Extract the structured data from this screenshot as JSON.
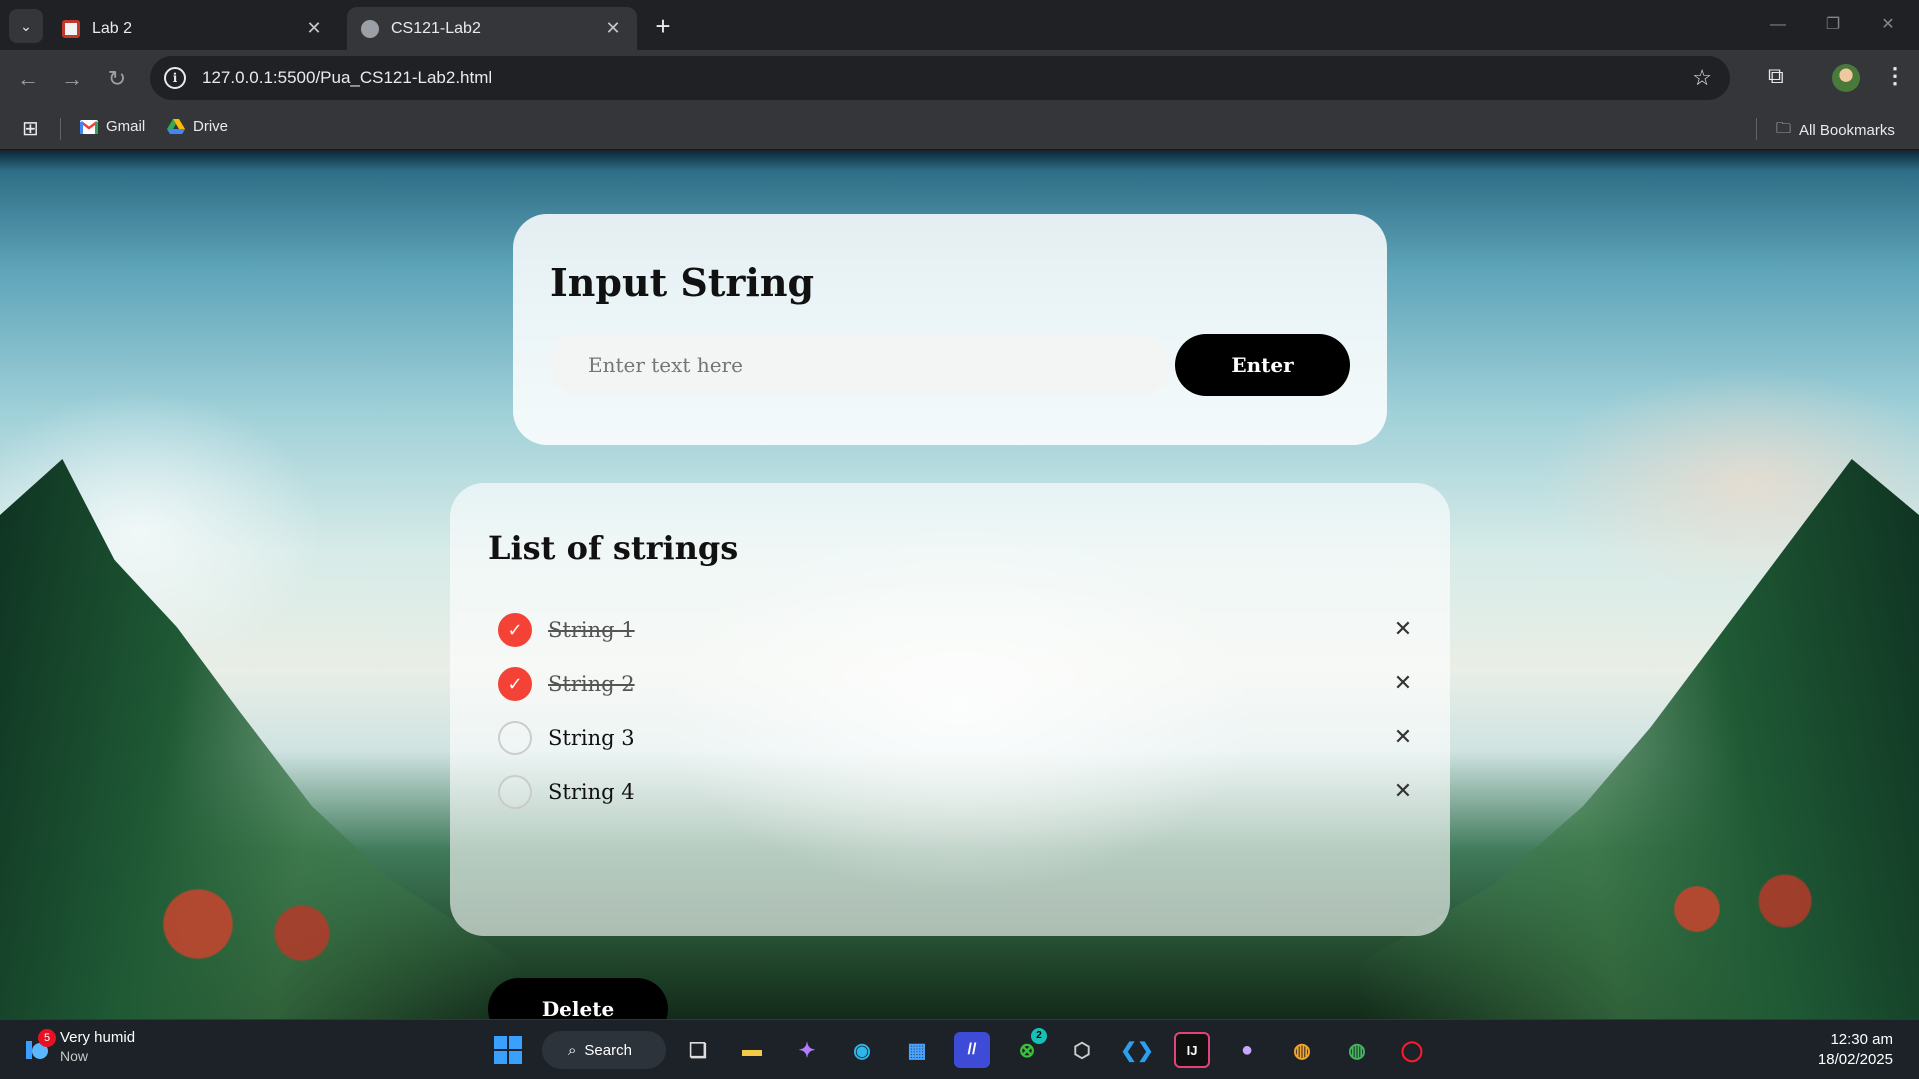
{
  "browser": {
    "tabs": [
      {
        "title": "Lab 2",
        "active": false
      },
      {
        "title": "CS121-Lab2",
        "active": true
      }
    ],
    "url": "127.0.0.1:5500/Pua_CS121-Lab2.html",
    "bookmarks": [
      {
        "label": "Gmail",
        "icon": "gmail-icon"
      },
      {
        "label": "Drive",
        "icon": "drive-icon"
      }
    ],
    "all_bookmarks": "All Bookmarks"
  },
  "page": {
    "input_card": {
      "title": "Input String",
      "placeholder": "Enter text here",
      "enter_label": "Enter"
    },
    "list_card": {
      "title": "List of strings",
      "items": [
        {
          "label": "String 1",
          "checked": true
        },
        {
          "label": "String 2",
          "checked": true
        },
        {
          "label": "String 3",
          "checked": false
        },
        {
          "label": "String 4",
          "checked": false
        }
      ],
      "delete_label": "Delete"
    },
    "colors": {
      "accent": "#f44336",
      "button": "#000000"
    }
  },
  "taskbar": {
    "weather": {
      "text": "Very humid",
      "sub": "Now",
      "badge": "5"
    },
    "search_label": "Search",
    "xbox_badge": "2",
    "clock": {
      "time": "12:30 am",
      "date": "18/02/2025"
    }
  }
}
